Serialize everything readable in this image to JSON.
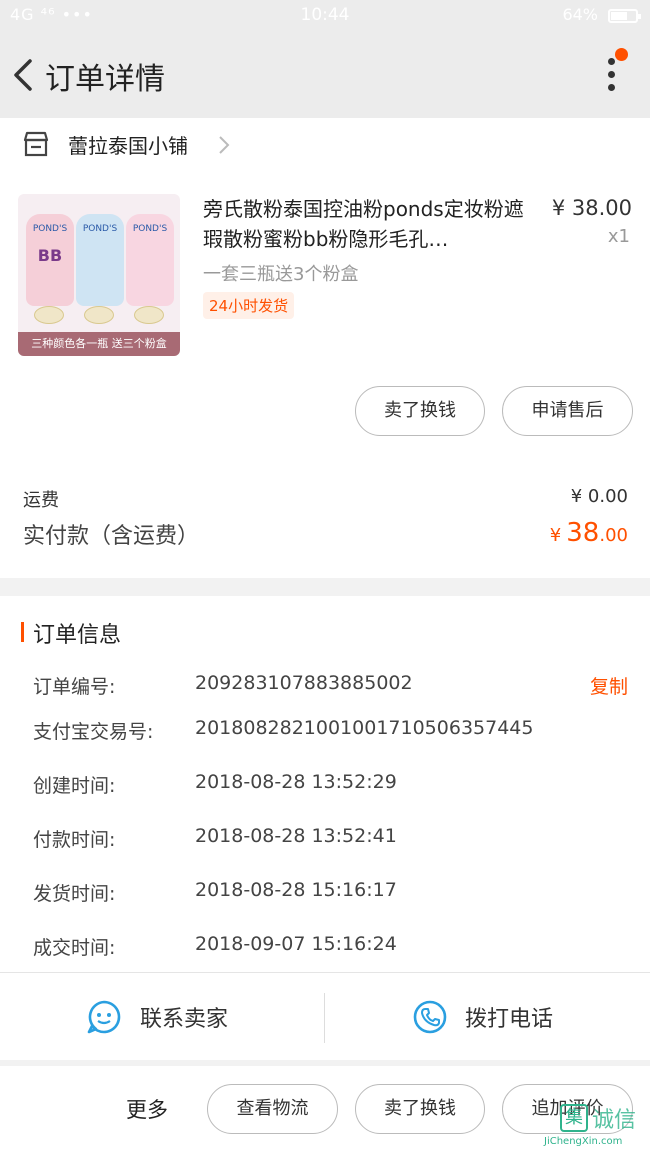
{
  "status_bar": {
    "left": "4G ⁴⁶ •••",
    "time": "10:44",
    "battery": "64%"
  },
  "nav": {
    "title": "订单详情",
    "icons": [
      "back-arrow-icon",
      "more-dots-icon",
      "notification-dot"
    ]
  },
  "store": {
    "name": "蕾拉泰国小铺",
    "icon": "store-icon"
  },
  "product": {
    "title": "旁氏散粉泰国控油粉ponds定妆粉遮瑕散粉蜜粉bb粉隐形毛孔…",
    "price": "¥ 38.00",
    "quantity": "x1",
    "sku": "一套三瓶送3个粉盒",
    "tag": "24小时发货",
    "image_brand": "POND'S",
    "image_bb": "BB",
    "image_banner": "三种颜色各一瓶 送三个粉盒",
    "actions": {
      "sell": "卖了换钱",
      "after_sale": "申请售后"
    }
  },
  "summary": {
    "shipping_label": "运费",
    "shipping_value": "¥ 0.00",
    "paid_label": "实付款（含运费）",
    "paid_currency": "¥",
    "paid_int": "38",
    "paid_dec": ".00"
  },
  "order_info": {
    "title": "订单信息",
    "copy": "复制",
    "rows": [
      {
        "label": "订单编号:",
        "value": "209283107883885002"
      },
      {
        "label": "支付宝交易号:",
        "value": "2018082821001001710506357445"
      },
      {
        "label": "创建时间:",
        "value": "2018-08-28 13:52:29"
      },
      {
        "label": "付款时间:",
        "value": "2018-08-28 13:52:41"
      },
      {
        "label": "发货时间:",
        "value": "2018-08-28 15:16:17"
      },
      {
        "label": "成交时间:",
        "value": "2018-09-07 15:16:24"
      }
    ]
  },
  "contact": {
    "seller": "联系卖家",
    "call": "拨打电话"
  },
  "bottom": {
    "more": "更多",
    "logistics": "查看物流",
    "sell": "卖了换钱",
    "review": "追加评价"
  },
  "watermark": {
    "box": "集",
    "cn": "诚信",
    "en": "JiChengXin.com"
  },
  "colors": {
    "accent": "#ff5000",
    "icon_blue": "#2a9fe0"
  }
}
